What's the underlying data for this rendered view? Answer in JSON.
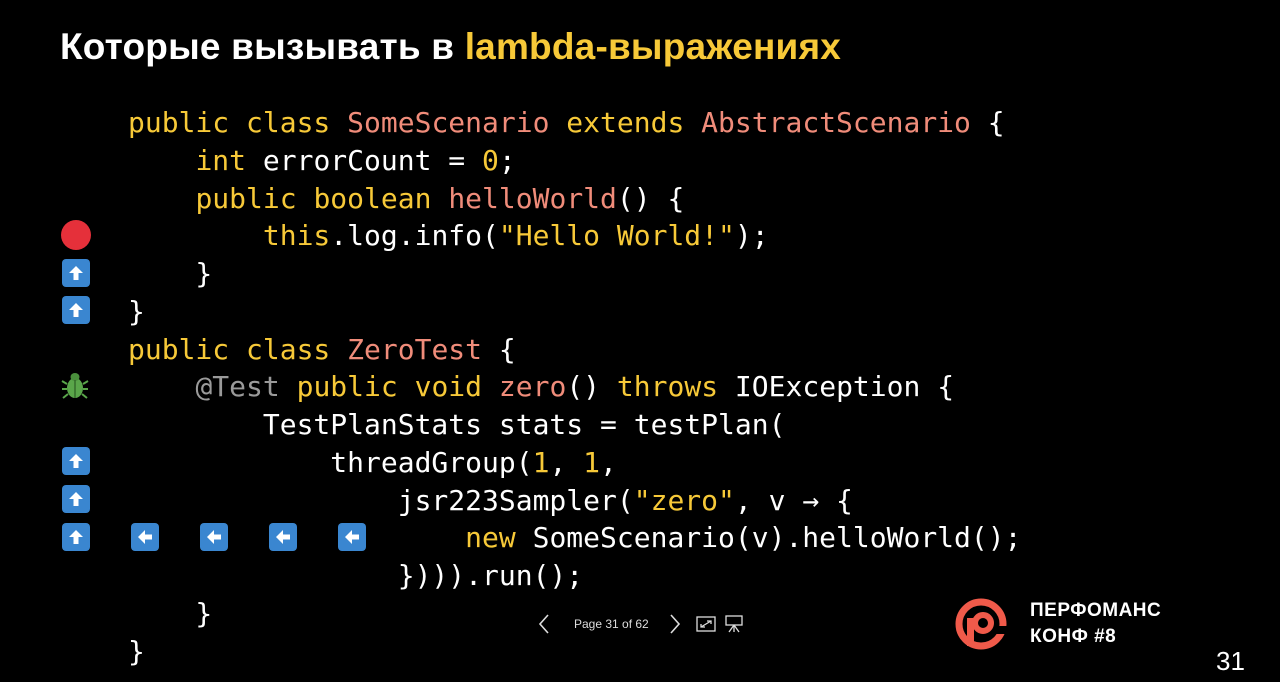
{
  "slide": {
    "title_part1": "Которые вызывать в ",
    "title_part2": "lambda-выражениях",
    "page_number": "31"
  },
  "code_lines": [
    [
      {
        "t": "public class ",
        "c": "kw"
      },
      {
        "t": "SomeScenario",
        "c": "cls"
      },
      {
        "t": " extends ",
        "c": "kw"
      },
      {
        "t": "AbstractScenario",
        "c": "cls"
      },
      {
        "t": " {",
        "c": "txt"
      }
    ],
    [
      {
        "t": "    ",
        "c": "txt"
      },
      {
        "t": "int",
        "c": "kw"
      },
      {
        "t": " errorCount = ",
        "c": "txt"
      },
      {
        "t": "0",
        "c": "num"
      },
      {
        "t": ";",
        "c": "txt"
      }
    ],
    [
      {
        "t": "    ",
        "c": "txt"
      },
      {
        "t": "public boolean ",
        "c": "kw"
      },
      {
        "t": "helloWorld",
        "c": "cls"
      },
      {
        "t": "() {",
        "c": "txt"
      }
    ],
    [
      {
        "t": "        ",
        "c": "txt"
      },
      {
        "t": "this",
        "c": "kw"
      },
      {
        "t": ".log.info(",
        "c": "txt"
      },
      {
        "t": "\"Hello World!\"",
        "c": "str"
      },
      {
        "t": ");",
        "c": "txt"
      }
    ],
    [
      {
        "t": "    }",
        "c": "txt"
      }
    ],
    [
      {
        "t": "}",
        "c": "txt"
      }
    ],
    [
      {
        "t": "public class ",
        "c": "kw"
      },
      {
        "t": "ZeroTest",
        "c": "cls"
      },
      {
        "t": " {",
        "c": "txt"
      }
    ],
    [
      {
        "t": "    ",
        "c": "txt"
      },
      {
        "t": "@Test",
        "c": "ann"
      },
      {
        "t": " public void ",
        "c": "kw"
      },
      {
        "t": "zero",
        "c": "cls"
      },
      {
        "t": "() ",
        "c": "txt"
      },
      {
        "t": "throws",
        "c": "kw"
      },
      {
        "t": " IOException {",
        "c": "txt"
      }
    ],
    [
      {
        "t": "        TestPlanStats stats = testPlan(",
        "c": "txt"
      }
    ],
    [
      {
        "t": "            threadGroup(",
        "c": "txt"
      },
      {
        "t": "1",
        "c": "num"
      },
      {
        "t": ", ",
        "c": "txt"
      },
      {
        "t": "1",
        "c": "num"
      },
      {
        "t": ",",
        "c": "txt"
      }
    ],
    [
      {
        "t": "                jsr223Sampler(",
        "c": "txt"
      },
      {
        "t": "\"zero\"",
        "c": "str"
      },
      {
        "t": ", v → {",
        "c": "txt"
      }
    ],
    [
      {
        "t": "                    ",
        "c": "txt"
      },
      {
        "t": "new",
        "c": "kw"
      },
      {
        "t": " SomeScenario(v).helloWorld();",
        "c": "txt"
      }
    ],
    [
      {
        "t": "                }))).run();",
        "c": "txt"
      }
    ],
    [
      {
        "t": "    }",
        "c": "txt"
      }
    ],
    [
      {
        "t": "}",
        "c": "txt"
      }
    ]
  ],
  "gutter_icons": [
    {
      "line": 3,
      "icon": "breakpoint-icon"
    },
    {
      "line": 4,
      "icon": "step-out-arrow-up-icon"
    },
    {
      "line": 5,
      "icon": "step-out-arrow-up-icon"
    },
    {
      "line": 7,
      "icon": "bug-icon"
    },
    {
      "line": 9,
      "icon": "step-out-arrow-up-icon"
    },
    {
      "line": 10,
      "icon": "step-out-arrow-up-icon"
    },
    {
      "line": 11,
      "icon": "step-out-arrow-up-icon"
    }
  ],
  "inline_icons": [
    "arrow-left-icon",
    "arrow-left-icon",
    "arrow-left-icon",
    "arrow-left-icon"
  ],
  "pager": {
    "label": "Page 31 of 62",
    "icons": [
      "chevron-left-icon",
      "chevron-right-icon",
      "fit-screen-icon",
      "presenter-icon"
    ]
  },
  "logo": {
    "line1": "ПЕРФОМАНС",
    "line2": "КОНФ #8",
    "color": "#f05a4a"
  },
  "colors": {
    "keyword": "#f7c938",
    "class_name": "#f08c7a",
    "annotation": "#9a9a9a",
    "gutter_arrow": "#3a86d0",
    "breakpoint": "#e5303a",
    "bug": "#5aa64a"
  }
}
